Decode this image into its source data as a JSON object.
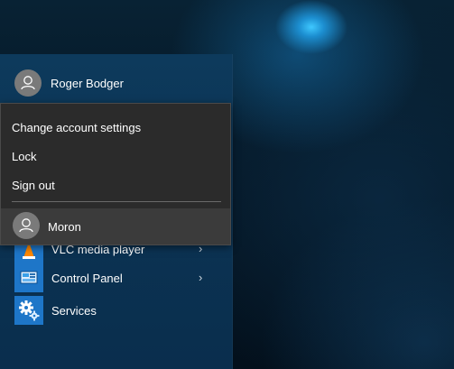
{
  "start_menu": {
    "user_name": "Roger Bodger",
    "apps": [
      {
        "label": "VLC media player",
        "icon": "vlc-icon",
        "has_submenu": true
      },
      {
        "label": "Control Panel",
        "icon": "control-panel-icon",
        "has_submenu": true
      },
      {
        "label": "Services",
        "icon": "services-gear-icon",
        "has_submenu": false
      }
    ],
    "submenu_glyph": "›"
  },
  "account_menu": {
    "items": [
      {
        "label": "Change account settings"
      },
      {
        "label": "Lock"
      },
      {
        "label": "Sign out"
      }
    ],
    "other_user": "Moron"
  },
  "colors": {
    "start_bg": "#0b3252",
    "flyout_bg": "#2b2b2b",
    "hover_bg": "#3b3b3b",
    "tile_blue": "#1e76c8",
    "avatar_gray": "#7a7a7a"
  }
}
